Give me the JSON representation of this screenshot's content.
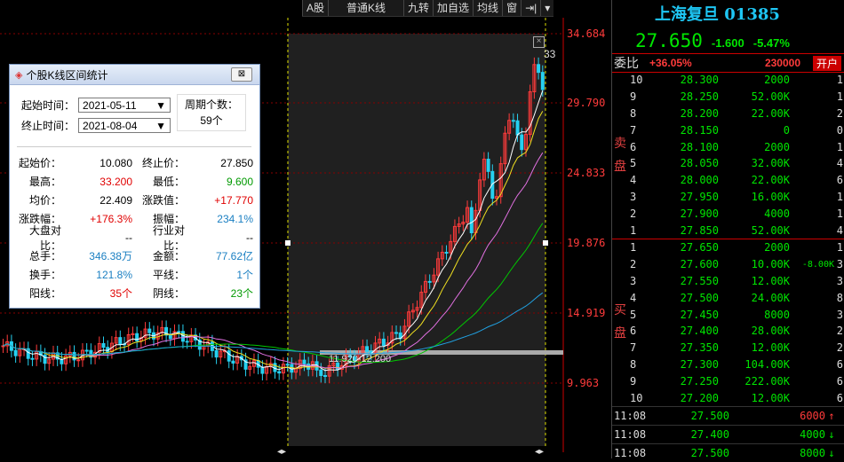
{
  "toolbar": {
    "market": "A股",
    "chart_type": "普通K线",
    "jiuzhuan": "九转",
    "add_watch": "加自选",
    "ma": "均线",
    "window": "窗",
    "pin": "⇥|",
    "dropdown": "▾"
  },
  "axis": {
    "labels": [
      "34.684",
      "29.790",
      "24.833",
      "19.876",
      "14.919",
      "9.963"
    ],
    "max_marker": "33",
    "low_marker": "11.920-12.200"
  },
  "dialog": {
    "title": "个股K线区间统计",
    "close": "⊠",
    "start_label": "起始时间：",
    "start_value": "2021-05-11",
    "end_label": "终止时间：",
    "end_value": "2021-08-04",
    "period_label": "周期个数：",
    "period_value": "59个",
    "stats": [
      {
        "l1": "起始价：",
        "v1": "10.080",
        "c1": "black",
        "l2": "终止价：",
        "v2": "27.850",
        "c2": "black"
      },
      {
        "l1": "最高：",
        "v1": "33.200",
        "c1": "red",
        "l2": "最低：",
        "v2": "9.600",
        "c2": "green"
      },
      {
        "l1": "均价：",
        "v1": "22.409",
        "c1": "black",
        "l2": "涨跌值：",
        "v2": "+17.770",
        "c2": "red"
      },
      {
        "l1": "涨跌幅：",
        "v1": "+176.3%",
        "c1": "red",
        "l2": "振幅：",
        "v2": "234.1%",
        "c2": "blue"
      },
      {
        "l1": "大盘对比：",
        "v1": "--",
        "c1": "black",
        "l2": "行业对比：",
        "v2": "--",
        "c2": "black"
      },
      {
        "l1": "总手：",
        "v1": "346.38万",
        "c1": "blue",
        "l2": "金额：",
        "v2": "77.62亿",
        "c2": "blue"
      },
      {
        "l1": "换手：",
        "v1": "121.8%",
        "c1": "blue",
        "l2": "平线：",
        "v2": "1个",
        "c2": "blue"
      },
      {
        "l1": "阳线：",
        "v1": "35个",
        "c1": "red",
        "l2": "阴线：",
        "v2": "23个",
        "c2": "green"
      }
    ]
  },
  "quote": {
    "name": "上海复旦 01385",
    "price": "27.650",
    "change": "-1.600",
    "change_pct": "-5.47%",
    "wb_label": "委比",
    "wb_value": "+36.05%",
    "wb_diff": "230000",
    "open_btn": "开户",
    "sell_label": "卖盘",
    "buy_label": "买盘",
    "asks": [
      {
        "lvl": "10",
        "price": "28.300",
        "vol": "2000",
        "cnt": "1"
      },
      {
        "lvl": "9",
        "price": "28.250",
        "vol": "52.00K",
        "cnt": "1"
      },
      {
        "lvl": "8",
        "price": "28.200",
        "vol": "22.00K",
        "cnt": "2"
      },
      {
        "lvl": "7",
        "price": "28.150",
        "vol": "0",
        "cnt": "0"
      },
      {
        "lvl": "6",
        "price": "28.100",
        "vol": "2000",
        "cnt": "1"
      },
      {
        "lvl": "5",
        "price": "28.050",
        "vol": "32.00K",
        "cnt": "4"
      },
      {
        "lvl": "4",
        "price": "28.000",
        "vol": "22.00K",
        "cnt": "6"
      },
      {
        "lvl": "3",
        "price": "27.950",
        "vol": "16.00K",
        "cnt": "1"
      },
      {
        "lvl": "2",
        "price": "27.900",
        "vol": "4000",
        "cnt": "1"
      },
      {
        "lvl": "1",
        "price": "27.850",
        "vol": "52.00K",
        "cnt": "4"
      }
    ],
    "bids": [
      {
        "lvl": "1",
        "price": "27.650",
        "vol": "2000",
        "delta": "",
        "cnt": "1"
      },
      {
        "lvl": "2",
        "price": "27.600",
        "vol": "10.00K",
        "delta": "-8.00K",
        "cnt": "3"
      },
      {
        "lvl": "3",
        "price": "27.550",
        "vol": "12.00K",
        "delta": "",
        "cnt": "3"
      },
      {
        "lvl": "4",
        "price": "27.500",
        "vol": "24.00K",
        "delta": "",
        "cnt": "8"
      },
      {
        "lvl": "5",
        "price": "27.450",
        "vol": "8000",
        "delta": "",
        "cnt": "3"
      },
      {
        "lvl": "6",
        "price": "27.400",
        "vol": "28.00K",
        "delta": "",
        "cnt": "2"
      },
      {
        "lvl": "7",
        "price": "27.350",
        "vol": "12.00K",
        "delta": "",
        "cnt": "2"
      },
      {
        "lvl": "8",
        "price": "27.300",
        "vol": "104.00K",
        "delta": "",
        "cnt": "6"
      },
      {
        "lvl": "9",
        "price": "27.250",
        "vol": "222.00K",
        "delta": "",
        "cnt": "6"
      },
      {
        "lvl": "10",
        "price": "27.200",
        "vol": "12.00K",
        "delta": "",
        "cnt": "6"
      }
    ],
    "trades": [
      {
        "time": "11:08",
        "price": "27.500",
        "vol": "6000",
        "dir": "up"
      },
      {
        "time": "11:08",
        "price": "27.400",
        "vol": "4000",
        "dir": "down"
      },
      {
        "time": "11:08",
        "price": "27.500",
        "vol": "8000",
        "dir": "down"
      }
    ]
  },
  "colors": {
    "up": "#ff3b3b",
    "down": "#26d0f0",
    "ma5": "#ffffff",
    "ma10": "#f0e020",
    "ma20": "#e070e0",
    "ma60": "#00c800",
    "ma120": "#20a0e0"
  }
}
